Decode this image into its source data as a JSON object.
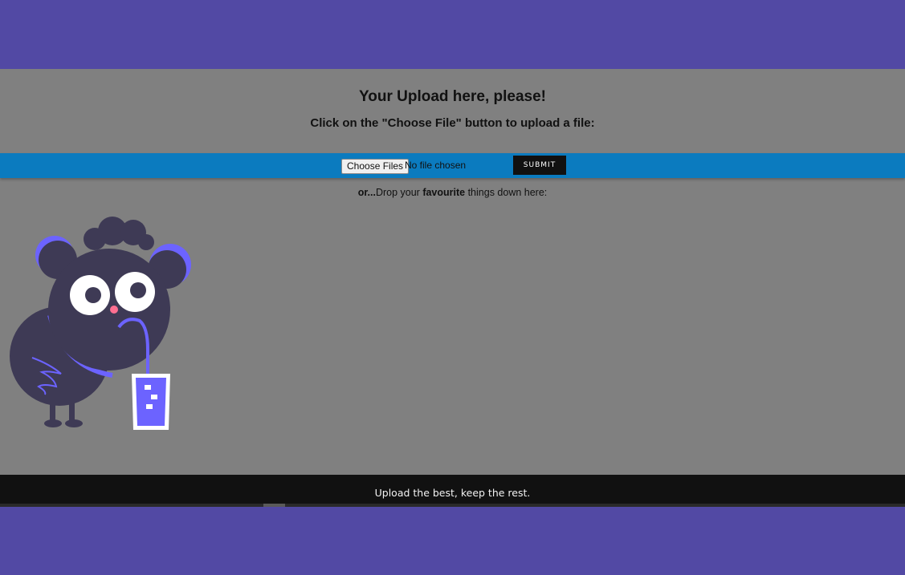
{
  "header": {
    "title": "Your Upload here, please!",
    "subtitle": "Click on the \"Choose File\" button to upload a file:"
  },
  "upload": {
    "choose_label": "Choose Files",
    "file_status": "No file chosen",
    "submit_label": "SUBMIT"
  },
  "drop": {
    "prefix": "or...",
    "text_before": "Drop your ",
    "emphasis": "favourite",
    "text_after": " things down here:"
  },
  "footer": {
    "tagline": "Upload the best, keep the rest."
  },
  "icons": {
    "mascot": "bird-mascot-drinking-icon"
  },
  "colors": {
    "background": "#5249a4",
    "panel": "#808080",
    "upload_bar": "#0b7bbf",
    "footer": "#111111",
    "mascot_body": "#3e3a55",
    "mascot_accent": "#6c63ff"
  }
}
